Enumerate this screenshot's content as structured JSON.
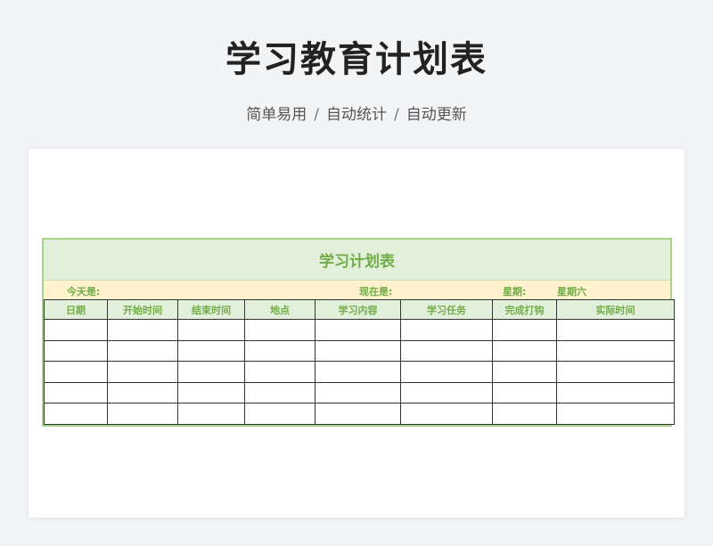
{
  "header": {
    "title": "学习教育计划表",
    "subtitle_parts": [
      "简单易用",
      "自动统计",
      "自动更新"
    ],
    "separator": "/"
  },
  "sheet": {
    "title": "学习计划表",
    "today_label": "今天是:",
    "now_label": "现在是:",
    "weekday_label": "星期:",
    "weekday_value": "星期六",
    "columns": [
      "日期",
      "开始时间",
      "结束时间",
      "地点",
      "学习内容",
      "学习任务",
      "完成打钩",
      "实际时间"
    ],
    "row_count": 5
  },
  "colors": {
    "accent_green": "#70ad47",
    "header_bg": "#e2efda",
    "info_bg": "#fff2cc",
    "border": "#a9d18e"
  }
}
